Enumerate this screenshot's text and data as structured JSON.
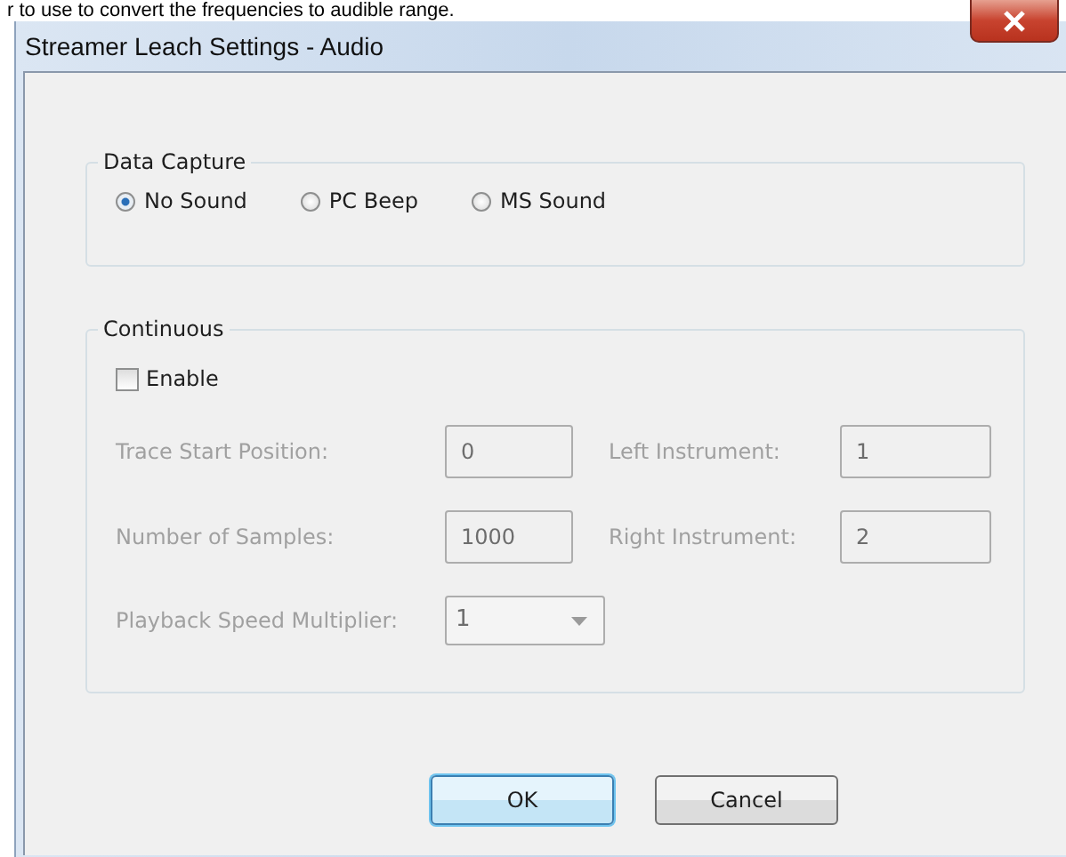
{
  "background_text": "r to use to convert the frequencies to audible range.",
  "window": {
    "title": "Streamer Leach Settings - Audio"
  },
  "data_capture": {
    "title": "Data Capture",
    "options": [
      {
        "label": "No Sound",
        "selected": true
      },
      {
        "label": "PC Beep",
        "selected": false
      },
      {
        "label": "MS Sound",
        "selected": false
      }
    ]
  },
  "continuous": {
    "title": "Continuous",
    "enable": {
      "label": "Enable",
      "checked": false
    },
    "fields": [
      {
        "label": "Trace Start Position:",
        "value": "0",
        "disabled": true
      },
      {
        "label": "Left Instrument:",
        "value": "1",
        "disabled": true
      },
      {
        "label": "Number of Samples:",
        "value": "1000",
        "disabled": true
      },
      {
        "label": "Right Instrument:",
        "value": "2",
        "disabled": true
      }
    ],
    "playback": {
      "label": "Playback Speed Multiplier:",
      "value": "1",
      "disabled": true
    }
  },
  "buttons": [
    {
      "label": "OK",
      "default": true
    },
    {
      "label": "Cancel",
      "default": false
    }
  ]
}
